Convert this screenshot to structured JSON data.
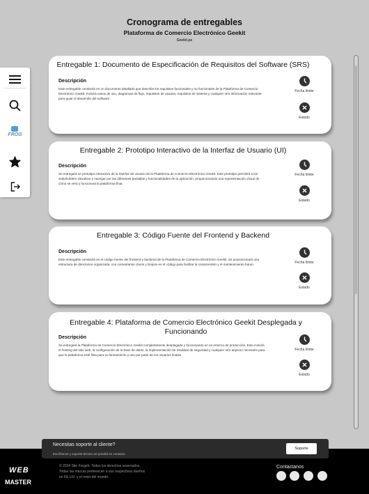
{
  "header": {
    "title": "Cronograma de entregables",
    "subtitle": "Plataforma de Comercio Electrónico Geekit",
    "site": "Geekit.pe"
  },
  "sidebar": {
    "items": [
      {
        "icon": "menu-icon"
      },
      {
        "icon": "search-icon"
      },
      {
        "icon": "frog-logo",
        "label": "FROG"
      },
      {
        "icon": "star-icon"
      },
      {
        "icon": "logout-icon"
      }
    ]
  },
  "cards": [
    {
      "title": "Entregable 1: Documento de Especificación de Requisitos del Software (SRS)",
      "desc_label": "Descripción",
      "desc": "Este entregable consistirá en un documento detallado que describe los requisitos funcionales y no funcionales de la Plataforma de Comercio Electrónico Geekit. Incluirá casos de uso, diagramas de flujo, requisitos de usuario, requisitos de sistema y cualquier otra información relevante para guiar el desarrollo del software.",
      "deadline_label": "Fecha límite",
      "status_label": "Estado"
    },
    {
      "title": "Entregable 2: Prototipo Interactivo de la Interfaz de Usuario (UI)",
      "desc_label": "Descripción",
      "desc": "Se entregará un prototipo interactivo de la interfaz de usuario de la Plataforma de Comercio Electrónico Geekit. Este prototipo permitirá a los stakeholders visualizar y navegar por las diferentes pantallas y funcionalidades de la aplicación, proporcionando una representación visual de cómo se verá y funcionará la plataforma final.",
      "deadline_label": "Fecha límite",
      "status_label": "Estado"
    },
    {
      "title": "Entregable 3: Código Fuente del Frontend y Backend",
      "desc_label": "Descripción",
      "desc": "Este entregable consistirá en el código fuente del frontend y backend de la Plataforma de Comercio Electrónico Geekit. Se proporcionará una estructura de directorios organizada, con comentarios claros y limpios en el código para facilitar la comprensión y el mantenimiento futuro.",
      "deadline_label": "Fecha límite",
      "status_label": "Estado"
    },
    {
      "title": "Entregable 4: Plataforma de Comercio Electrónico Geekit Desplegada y Funcionando",
      "desc_label": "Descripción",
      "desc": "Se entregará la Plataforma de Comercio Electrónico Geekit completamente desplegada y funcionando en un entorno de producción. Esto incluirá el hosting del sitio web, la configuración de la base de datos, la implementación de medidas de seguridad y cualquier otro aspecto necesario para que la plataforma esté lista para su lanzamiento y uso por parte de los usuarios finales.",
      "deadline_label": "Fecha límite",
      "status_label": "Estado"
    }
  ],
  "support": {
    "title": "Necesitas soporte al cliente?",
    "subtitle": "Escríbenos y soporte técnico se pondrá en contacto.",
    "button": "Soporte"
  },
  "footer": {
    "logo_top": "WEB",
    "logo_bottom": "MASTER",
    "copyright": "© 2024 Site Forgeh. Todos los derechos reservados. Todas las marcas pertenecen a sus respectivos dueños en EE.UU. y el resto del mundo.",
    "contact_label": "Contactanos"
  }
}
